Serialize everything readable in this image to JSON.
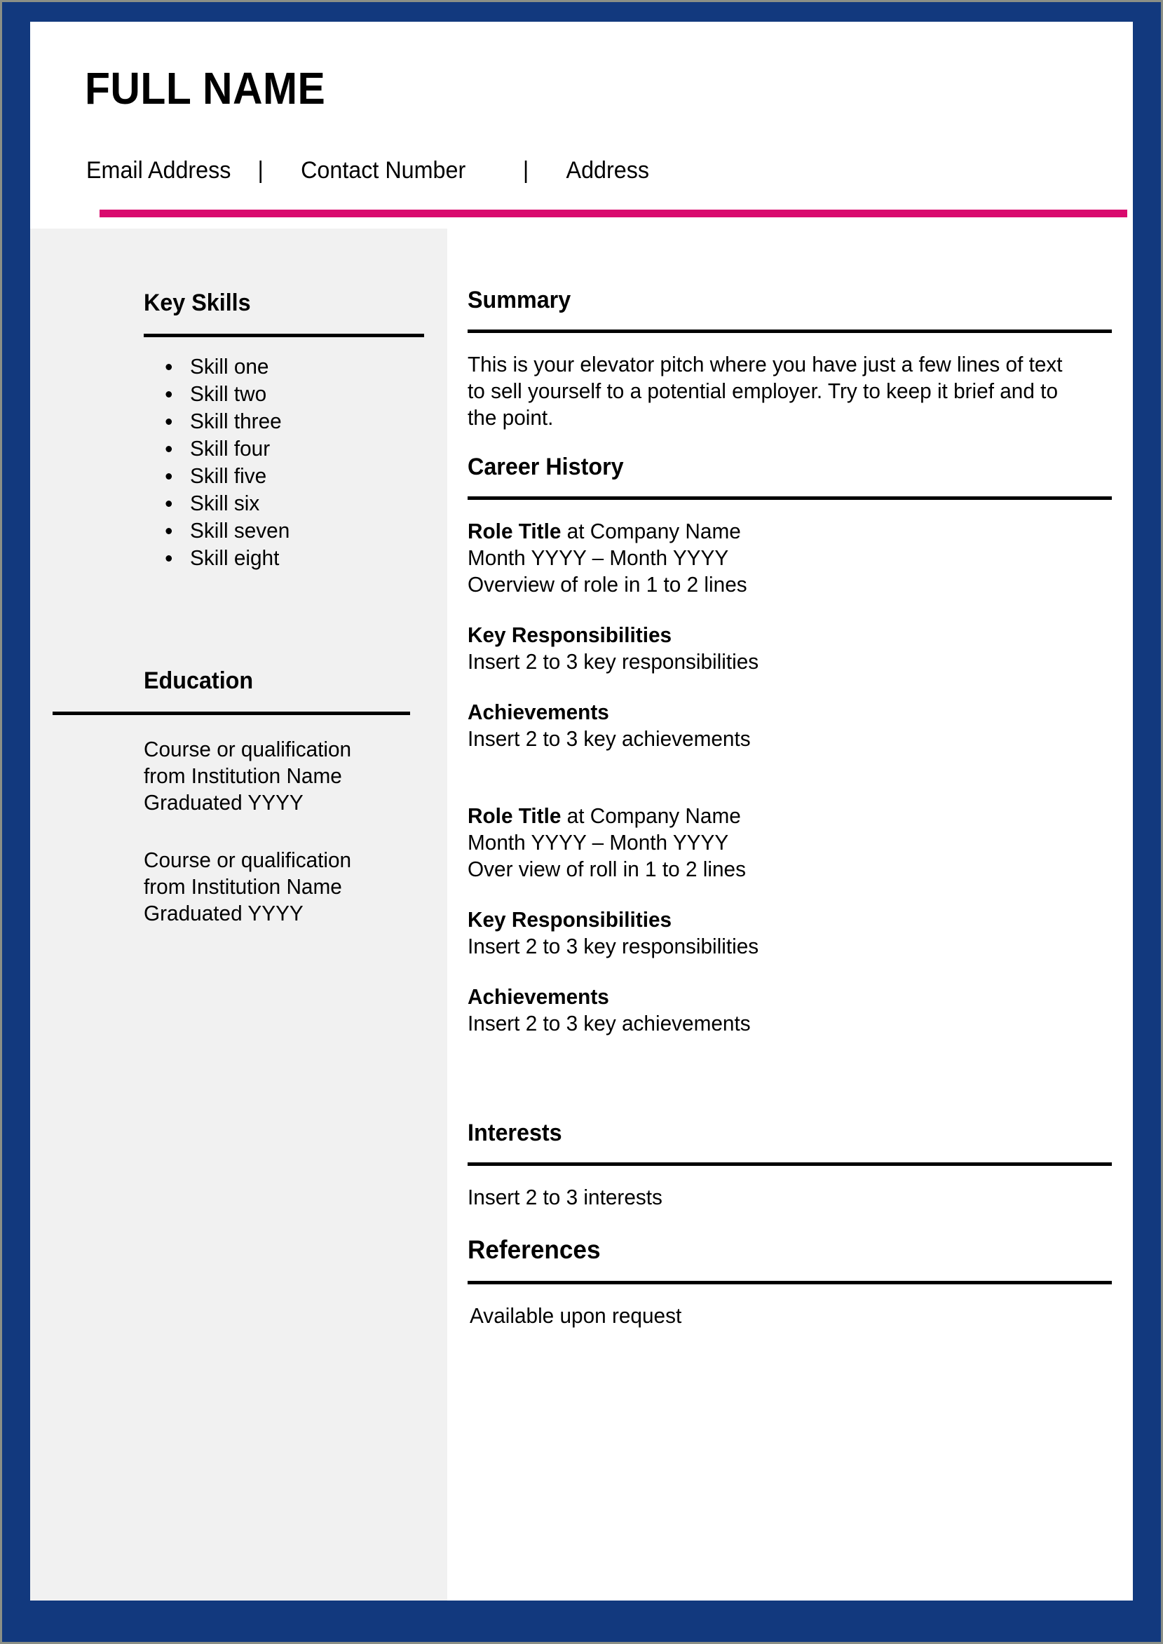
{
  "header": {
    "full_name": "FULL NAME",
    "contact": {
      "email_label": "Email Address",
      "separator_1": "|",
      "phone_label": "Contact Number",
      "separator_2": "|",
      "address_label": "Address"
    }
  },
  "colors": {
    "page_border_blue": "#12397e",
    "accent_pink": "#d90a6e",
    "sidebar_gray": "#f1f1f1",
    "rule_black": "#000000"
  },
  "sidebar": {
    "key_skills": {
      "heading": "Key Skills",
      "items": [
        "Skill one",
        "Skill two",
        "Skill three",
        "Skill four",
        "Skill five",
        "Skill six",
        "Skill seven",
        "Skill eight"
      ]
    },
    "education": {
      "heading": "Education",
      "entries": [
        {
          "course": "Course or qualification",
          "institution": "from Institution Name",
          "graduated": "Graduated YYYY"
        },
        {
          "course": "Course or qualification",
          "institution": "from Institution Name",
          "graduated": "Graduated YYYY"
        }
      ]
    }
  },
  "main": {
    "summary": {
      "heading": "Summary",
      "body": "This is your elevator pitch where you have just a few lines of text to sell yourself to a potential employer. Try to keep it brief and to the point."
    },
    "career_history": {
      "heading": "Career History",
      "jobs": [
        {
          "role_title": "Role Title",
          "at_company": " at Company Name",
          "dates": "Month YYYY – Month YYYY",
          "overview": "Overview of role in 1 to 2 lines",
          "responsibilities_heading": "Key Responsibilities",
          "responsibilities_body": "Insert 2 to 3 key responsibilities",
          "achievements_heading": "Achievements",
          "achievements_body": "Insert 2 to 3 key achievements"
        },
        {
          "role_title": "Role Title",
          "at_company": " at Company Name",
          "dates": "Month YYYY – Month YYYY",
          "overview": "Over view of roll in 1 to 2 lines",
          "responsibilities_heading": "Key Responsibilities",
          "responsibilities_body": "Insert 2 to 3 key responsibilities",
          "achievements_heading": "Achievements",
          "achievements_body": "Insert 2 to 3 key achievements"
        }
      ]
    },
    "interests": {
      "heading": "Interests",
      "body": "Insert 2 to 3 interests"
    },
    "references": {
      "heading": "References",
      "body": "Available upon request"
    }
  }
}
